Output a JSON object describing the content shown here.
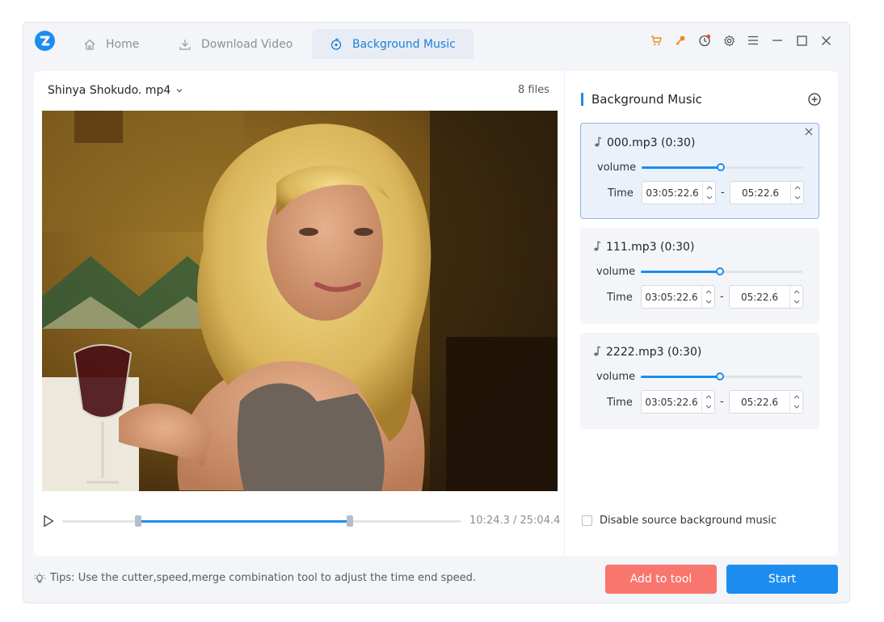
{
  "tabs": [
    {
      "label": "Home",
      "icon": "home-icon"
    },
    {
      "label": "Download Video",
      "icon": "download-icon"
    },
    {
      "label": "Background Music",
      "icon": "music-disc-icon",
      "active": true
    }
  ],
  "toolbar_icons": [
    "cart-icon",
    "key-icon",
    "update-icon",
    "gear-icon",
    "menu-icon",
    "minimize-icon",
    "maximize-icon",
    "close-icon"
  ],
  "colors": {
    "accent": "#1c8cf0",
    "add_button": "#f8766d",
    "cart": "#f08a24",
    "key": "#f08a24",
    "notification_dot": "#f04545"
  },
  "player": {
    "file_name": "Shinya Shokudo. mp4",
    "file_count": "8 files",
    "timecode": "10:24.3 / 25:04.4",
    "selection_start_fraction": 0.19,
    "selection_end_fraction": 0.72
  },
  "music_panel": {
    "title": "Background Music",
    "items": [
      {
        "name": "000.mp3 (0:30)",
        "volume_label": "volume",
        "volume_fraction": 0.49,
        "time_label": "Time",
        "start": "03:05:22.6",
        "end": "05:22.6",
        "selected": true
      },
      {
        "name": "111.mp3 (0:30)",
        "volume_label": "volume",
        "volume_fraction": 0.49,
        "time_label": "Time",
        "start": "03:05:22.6",
        "end": "05:22.6",
        "selected": false
      },
      {
        "name": "2222.mp3 (0:30)",
        "volume_label": "volume",
        "volume_fraction": 0.49,
        "time_label": "Time",
        "start": "03:05:22.6",
        "end": "05:22.6",
        "selected": false
      }
    ],
    "dash": "-",
    "disable_label": "Disable source background music"
  },
  "footer": {
    "tips": "Tips: Use the cutter,speed,merge combination tool to adjust the time end speed.",
    "add_button": "Add to tool",
    "start_button": "Start"
  }
}
